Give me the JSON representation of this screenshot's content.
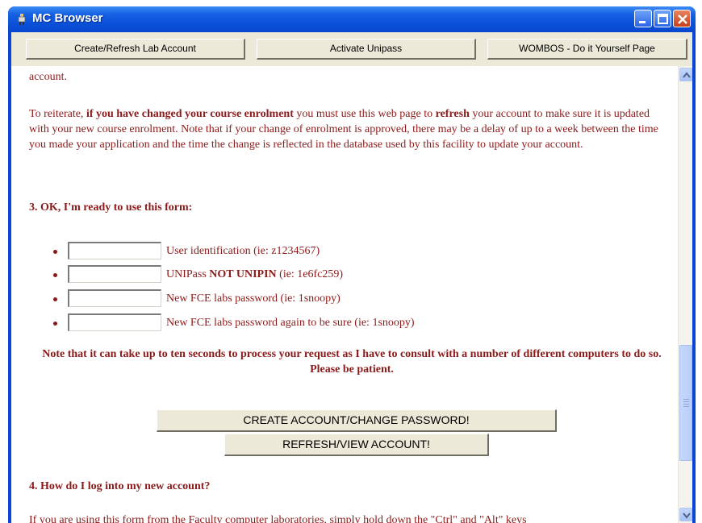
{
  "window": {
    "title": "MC Browser",
    "icon": "app-icon",
    "controls": [
      "minimize-icon",
      "maximize-icon",
      "close-icon"
    ]
  },
  "toolbar": {
    "buttons": [
      "Create/Refresh Lab Account",
      "Activate Unipass",
      "WOMBOS - Do it Yourself Page"
    ]
  },
  "content": {
    "top_text": "account.",
    "reiterate": {
      "p1": "To reiterate, ",
      "b1": "if you have changed your course enrolment",
      "p2": " you must use this web page to ",
      "b2": "refresh",
      "p3": " your account to make sure it is updated with your new course enrolment. Note that if your change of enrolment is approved, there may be a delay of up to a week between the time you made your application and the time the change is reflected in the database used by this facility to update your account."
    },
    "section3_heading": "3. OK, I'm ready to use this form:",
    "fields": [
      {
        "label": "User identification (ie: z1234567)",
        "value": ""
      },
      {
        "label_a": "UNIPass ",
        "label_b": "NOT UNIPIN",
        "label_c": " (ie: 1e6fc259)",
        "value": ""
      },
      {
        "label": "New FCE labs password (ie: 1snoopy)",
        "value": ""
      },
      {
        "label": "New FCE labs password again to be sure (ie: 1snoopy)",
        "value": ""
      }
    ],
    "note": "Note that it can take up to ten seconds to process your request as I have to consult with a number of different computers to do so. Please be patient.",
    "create_button": "CREATE ACCOUNT/CHANGE PASSWORD!",
    "refresh_button": "REFRESH/VIEW ACCOUNT!",
    "section4_heading": "4. How do I log into my new account?",
    "bottom_text": "If you are using this form from the Faculty computer laboratories, simply hold down the \"Ctrl\" and \"Alt\" keys"
  },
  "colors": {
    "text": "#8b1a1a",
    "titlebar": "#0a4fd8",
    "button_face": "#ece9d8"
  }
}
